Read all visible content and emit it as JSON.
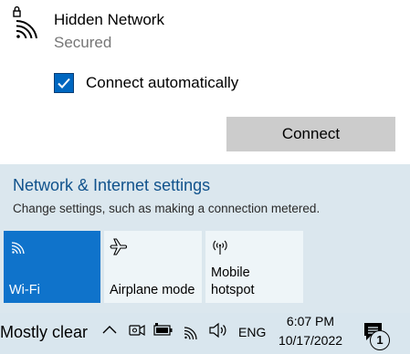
{
  "network": {
    "name": "Hidden Network",
    "status": "Secured",
    "auto_connect_label": "Connect automatically",
    "auto_connect_checked": true,
    "connect_button": "Connect"
  },
  "settings": {
    "title": "Network & Internet settings",
    "subtitle": "Change settings, such as making a connection metered."
  },
  "quick_actions": [
    {
      "label": "Wi-Fi",
      "icon": "wifi-icon",
      "active": true
    },
    {
      "label": "Airplane mode",
      "icon": "airplane-icon",
      "active": false
    },
    {
      "label_line1": "Mobile",
      "label_line2": "hotspot",
      "icon": "hotspot-icon",
      "active": false
    }
  ],
  "taskbar": {
    "weather": "Mostly clear",
    "language": "ENG",
    "time": "6:07 PM",
    "date": "10/17/2022",
    "notification_count": "1"
  },
  "colors": {
    "accent": "#0f73cb",
    "link": "#10528c",
    "flyout_bottom": "#dbe7ee",
    "tile_inactive": "#eef5f8",
    "button": "#cccccc"
  }
}
